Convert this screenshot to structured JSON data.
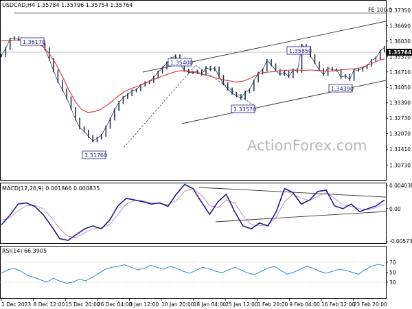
{
  "chart_data": [
    {
      "type": "line",
      "title": "USDCAD,H4 1.35784 1.35796 1.35754 1.35764",
      "ylim": [
        1.303,
        1.3755
      ],
      "y_ticks": [
        "1.37350",
        "1.36690",
        "1.36030",
        "1.35370",
        "1.34710",
        "1.34050",
        "1.33390",
        "1.32730",
        "1.32070",
        "1.31410",
        "1.30730"
      ],
      "current_price": "1.35764",
      "fib_label": "FE 100.0",
      "fib_level": 1.3735,
      "watermark": "ActionForex.com",
      "series": [
        {
          "name": "price",
          "color": "#0d2a4f",
          "values": [
            1.354,
            1.3571,
            1.3612,
            1.3617,
            1.3609,
            1.3605,
            1.3602,
            1.361,
            1.3591,
            1.359,
            1.357,
            1.3525,
            1.3475,
            1.343,
            1.3395,
            1.336,
            1.3315,
            1.327,
            1.3232,
            1.3218,
            1.3195,
            1.3176,
            1.3188,
            1.32,
            1.3235,
            1.327,
            1.331,
            1.334,
            1.3362,
            1.3374,
            1.339,
            1.3395,
            1.3414,
            1.3425,
            1.343,
            1.3448,
            1.347,
            1.3488,
            1.351,
            1.3528,
            1.354,
            1.3505,
            1.3478,
            1.347,
            1.3468,
            1.3474,
            1.346,
            1.349,
            1.348,
            1.3488,
            1.3452,
            1.342,
            1.3398,
            1.338,
            1.337,
            1.3358,
            1.3385,
            1.3395,
            1.3432,
            1.3466,
            1.348,
            1.352,
            1.3501,
            1.3478,
            1.346,
            1.347,
            1.345,
            1.348,
            1.3474,
            1.3585,
            1.3575,
            1.354,
            1.351,
            1.348,
            1.346,
            1.3487,
            1.348,
            1.3479,
            1.3448,
            1.3456,
            1.3439,
            1.348,
            1.3478,
            1.3488,
            1.3498,
            1.352,
            1.353,
            1.356,
            1.3576
          ]
        },
        {
          "name": "moving-average",
          "color": "#e03030",
          "values": [
            1.3605,
            1.3606,
            1.3607,
            1.3607,
            1.3606,
            1.3602,
            1.3592,
            1.3572,
            1.354,
            1.3497,
            1.3444,
            1.339,
            1.3343,
            1.331,
            1.3298,
            1.3301,
            1.331,
            1.3327,
            1.3348,
            1.337,
            1.3388,
            1.34,
            1.3409,
            1.3419,
            1.3431,
            1.3442,
            1.3453,
            1.3462,
            1.3471,
            1.3476,
            1.3476,
            1.3471,
            1.3464,
            1.3458,
            1.3451,
            1.3443,
            1.3437,
            1.3432,
            1.3428,
            1.3431,
            1.344,
            1.3454,
            1.3466,
            1.347,
            1.3472,
            1.3476,
            1.3478,
            1.3479,
            1.3479,
            1.3478,
            1.3479,
            1.3478,
            1.3476,
            1.3474,
            1.3476,
            1.348,
            1.3482,
            1.3484,
            1.3488,
            1.3497,
            1.3508,
            1.352,
            1.3527
          ]
        }
      ],
      "annotations": [
        "1.36170",
        "1.35400",
        "1.35850",
        "1.31760",
        "1.33570",
        "1.34390"
      ]
    },
    {
      "type": "line",
      "title": "MACD(12,26,9) 0.001866 0.000835",
      "ylim": [
        -0.005737,
        0.004038
      ],
      "y_ticks": [
        "0.004038",
        "0.00",
        "-0.005737"
      ],
      "series": [
        {
          "name": "macd",
          "color": "#1a1a8c",
          "values": [
            -0.0028,
            -0.0012,
            0.0008,
            0.001,
            0.0004,
            -0.001,
            -0.003,
            -0.0052,
            -0.0055,
            -0.0045,
            -0.0035,
            -0.003,
            -0.0035,
            -0.002,
            0.0005,
            0.0018,
            0.0015,
            0.0012,
            0.0008,
            0.001,
            0.0004,
            0.0025,
            0.0042,
            0.0035,
            0.0012,
            -0.001,
            0.0012,
            0.0025,
            -0.0005,
            -0.003,
            -0.0035,
            -0.0025,
            -0.003,
            -0.0005,
            0.0035,
            0.0028,
            0.0008,
            0.0015,
            0.003,
            0.0032,
            0.0005,
            0.0,
            0.0008,
            -0.0005,
            0.0,
            0.0005,
            0.0015
          ]
        },
        {
          "name": "signal",
          "color": "#c070c0",
          "values": [
            -0.002,
            -0.0016,
            -0.0004,
            0.0005,
            0.0006,
            0.0,
            -0.0015,
            -0.0035,
            -0.0048,
            -0.005,
            -0.0042,
            -0.0035,
            -0.0033,
            -0.0028,
            -0.001,
            0.0008,
            0.0014,
            0.0014,
            0.001,
            0.0009,
            0.0007,
            0.0014,
            0.003,
            0.0035,
            0.0024,
            0.0005,
            0.0002,
            0.0015,
            0.001,
            -0.0012,
            -0.0028,
            -0.003,
            -0.0028,
            -0.0015,
            0.0012,
            0.0025,
            0.0018,
            0.0014,
            0.0022,
            0.0028,
            0.0018,
            0.0006,
            0.0004,
            0.0,
            -0.0002,
            0.0002,
            0.0008
          ]
        }
      ]
    },
    {
      "type": "line",
      "title": "RSI(14) 66.3905",
      "ylim": [
        0,
        100
      ],
      "y_ticks": [
        "70",
        "50",
        "30"
      ],
      "series": [
        {
          "name": "rsi",
          "color": "#2a8ad4",
          "values": [
            48,
            55,
            58,
            52,
            44,
            40,
            35,
            30,
            38,
            32,
            28,
            30,
            36,
            33,
            40,
            48,
            56,
            60,
            62,
            65,
            60,
            55,
            58,
            64,
            60,
            56,
            62,
            58,
            52,
            48,
            54,
            60,
            57,
            52,
            49,
            55,
            60,
            54,
            48,
            45,
            52,
            58,
            62,
            54,
            46,
            50,
            56,
            62,
            58,
            52,
            48,
            52,
            56,
            54,
            50,
            46,
            55,
            62,
            66,
            63
          ]
        }
      ]
    }
  ],
  "x_axis_labels": [
    "1 Dec 2023",
    "8 Dec 12:00",
    "15 Dec 20:00",
    "26 Dec 04:00",
    "3 Jan 12:00",
    "10 Jan 20:00",
    "18 Jan 04:00",
    "25 Jan 12:00",
    "1 Feb 20:00",
    "9 Feb 04:00",
    "16 Feb 12:00",
    "23 Feb 20:00"
  ]
}
